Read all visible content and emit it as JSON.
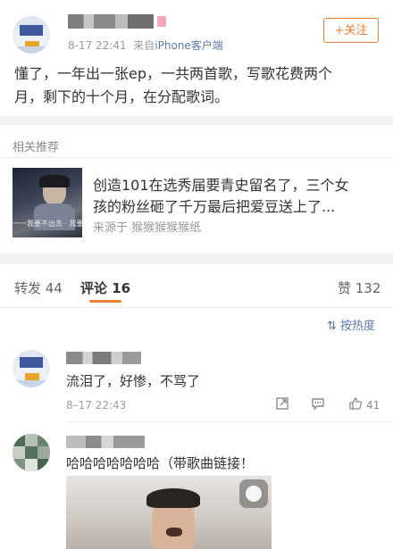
{
  "post": {
    "time": "8-17 22:41",
    "source_prefix": "来自",
    "source": "iPhone客户端",
    "follow_label": "+关注",
    "text_line1": "懂了，一年出一张ep，一共两首歌，写歌花费两个",
    "text_line2": "月，剩下的十个月，在分配歌词。"
  },
  "related": {
    "section_title": "相关推荐",
    "title_line1": "创造101在选秀届要青史留名了，三个女",
    "title_line2": "孩的粉丝砸了千万最后把爱豆送上了...",
    "source": "来源于 猴猴猴猴猴纸",
    "thumb_caption": "一一我要不出去 · 我要刘"
  },
  "tabs": {
    "repost": "转发 44",
    "comments": "评论 16",
    "likes": "赞 132"
  },
  "sort_label": "按热度",
  "comments": [
    {
      "text": "流泪了，好惨，不骂了",
      "time": "8–17 22:43",
      "likes": "41"
    },
    {
      "text": "哈哈哈哈哈哈哈（带歌曲链接！"
    }
  ],
  "colors": {
    "accent": "#f08033",
    "link": "#5b7bb1",
    "divider": "#f2f2f2"
  }
}
